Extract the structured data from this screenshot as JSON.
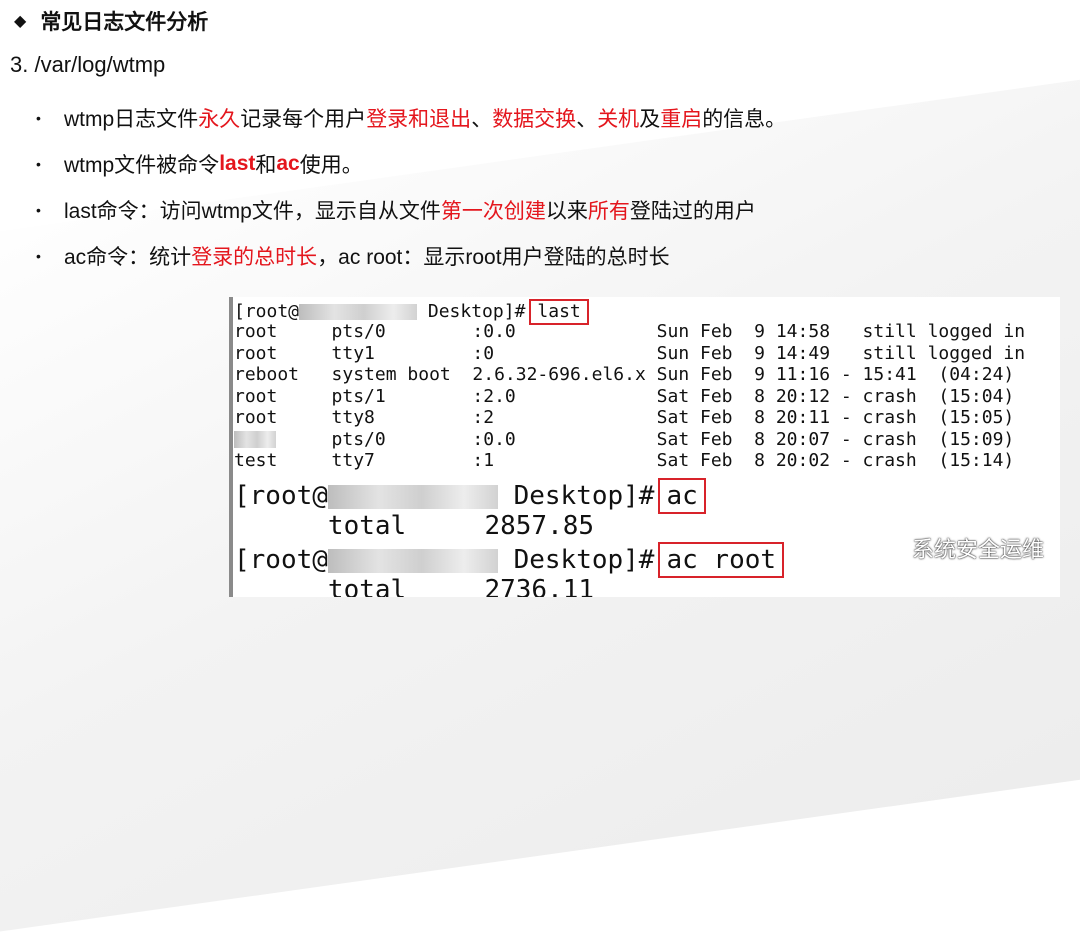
{
  "section_title": "常见日志文件分析",
  "subtitle": "3.  /var/log/wtmp",
  "bullets": [
    [
      {
        "text": "wtmp日志文件",
        "red": false
      },
      {
        "text": "永久",
        "red": true
      },
      {
        "text": "记录每个用户",
        "red": false
      },
      {
        "text": "登录和退出",
        "red": true
      },
      {
        "text": "、",
        "red": false
      },
      {
        "text": "数据交换",
        "red": true
      },
      {
        "text": "、",
        "red": false
      },
      {
        "text": "关机",
        "red": true
      },
      {
        "text": "及",
        "red": false
      },
      {
        "text": "重启",
        "red": true
      },
      {
        "text": "的信息。",
        "red": false
      }
    ],
    [
      {
        "text": "wtmp文件被命令",
        "red": false
      },
      {
        "text": "last",
        "red": true
      },
      {
        "text": "和",
        "red": false
      },
      {
        "text": "ac",
        "red": true
      },
      {
        "text": "使用。",
        "red": false
      }
    ],
    [
      {
        "text": "last命令：访问wtmp文件，显示自从文件",
        "red": false
      },
      {
        "text": "第一次创建",
        "red": true
      },
      {
        "text": "以来",
        "red": false
      },
      {
        "text": "所有",
        "red": true
      },
      {
        "text": "登陆过的用户",
        "red": false
      }
    ],
    [
      {
        "text": "ac命令：统计",
        "red": false
      },
      {
        "text": "登录的总时长",
        "red": true
      },
      {
        "text": "，ac root：显示root用户登陆的总时长",
        "red": false
      }
    ]
  ],
  "terminal": {
    "prompt1_prefix": "[root@",
    "prompt1_suffix": " Desktop]#",
    "cmd1": "last",
    "rows": [
      "root     pts/0        :0.0             Sun Feb  9 14:58   still logged in",
      "root     tty1         :0               Sun Feb  9 14:49   still logged in",
      "reboot   system boot  2.6.32-696.el6.x Sun Feb  9 11:16 - 15:41  (04:24)",
      "root     pts/1        :2.0             Sat Feb  8 20:12 - crash  (15:04)",
      "root     tty8         :2               Sat Feb  8 20:11 - crash  (15:05)",
      "         pts/0        :0.0             Sat Feb  8 20:07 - crash  (15:09)",
      "test     tty7         :1               Sat Feb  8 20:02 - crash  (15:14)"
    ],
    "prompt2_prefix": "[root@",
    "prompt2_suffix": " Desktop]#",
    "cmd2": "ac",
    "total1": "      total     2857.85",
    "prompt3_prefix": "[root@",
    "prompt3_suffix": " Desktop]#",
    "cmd3": "ac root",
    "total2": "      total     2736.11"
  },
  "watermark": "系统安全运维"
}
